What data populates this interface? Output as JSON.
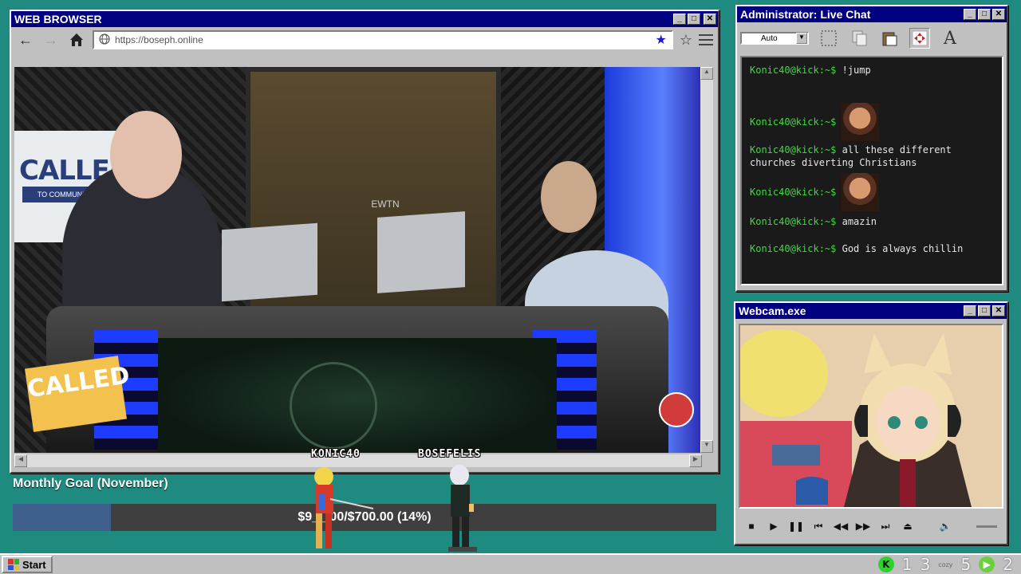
{
  "browser": {
    "title": "WEB BROWSER",
    "url": "https://boseph.online",
    "nav": {
      "back": "←",
      "forward": "→",
      "home": "⌂"
    }
  },
  "stream": {
    "called_logo_1": "CALLED",
    "called_logo_1_sub": "TO COMMUNION",
    "called_logo_2": "CALLED",
    "center_logo": "EWTN"
  },
  "goal": {
    "title": "Monthly Goal (November)",
    "text": "$9__.00/$700.00 (14%)",
    "progress_fraction": 0.14
  },
  "characters": [
    {
      "name": "KONIC40"
    },
    {
      "name": "BOSEFELIS"
    }
  ],
  "chat": {
    "title": "Administrator: Live Chat",
    "select_value": "Auto",
    "messages": [
      {
        "user": "Konic40@kick:~$",
        "text": "!jump",
        "emote": false
      },
      {
        "user": "Konic40@kick:~$",
        "text": "",
        "emote": true
      },
      {
        "user": "Konic40@kick:~$",
        "text": "all these different churches diverting Christians",
        "emote": false
      },
      {
        "user": "Konic40@kick:~$",
        "text": "",
        "emote": true
      },
      {
        "user": "Konic40@kick:~$",
        "text": "amazin",
        "emote": false
      },
      {
        "user": "Konic40@kick:~$",
        "text": "God is always chillin",
        "emote": false
      }
    ]
  },
  "webcam": {
    "title": "Webcam.exe"
  },
  "taskbar": {
    "start_label": "Start",
    "tray": [
      "1",
      "3",
      "5",
      "2"
    ],
    "cozy_label": "cozy"
  }
}
